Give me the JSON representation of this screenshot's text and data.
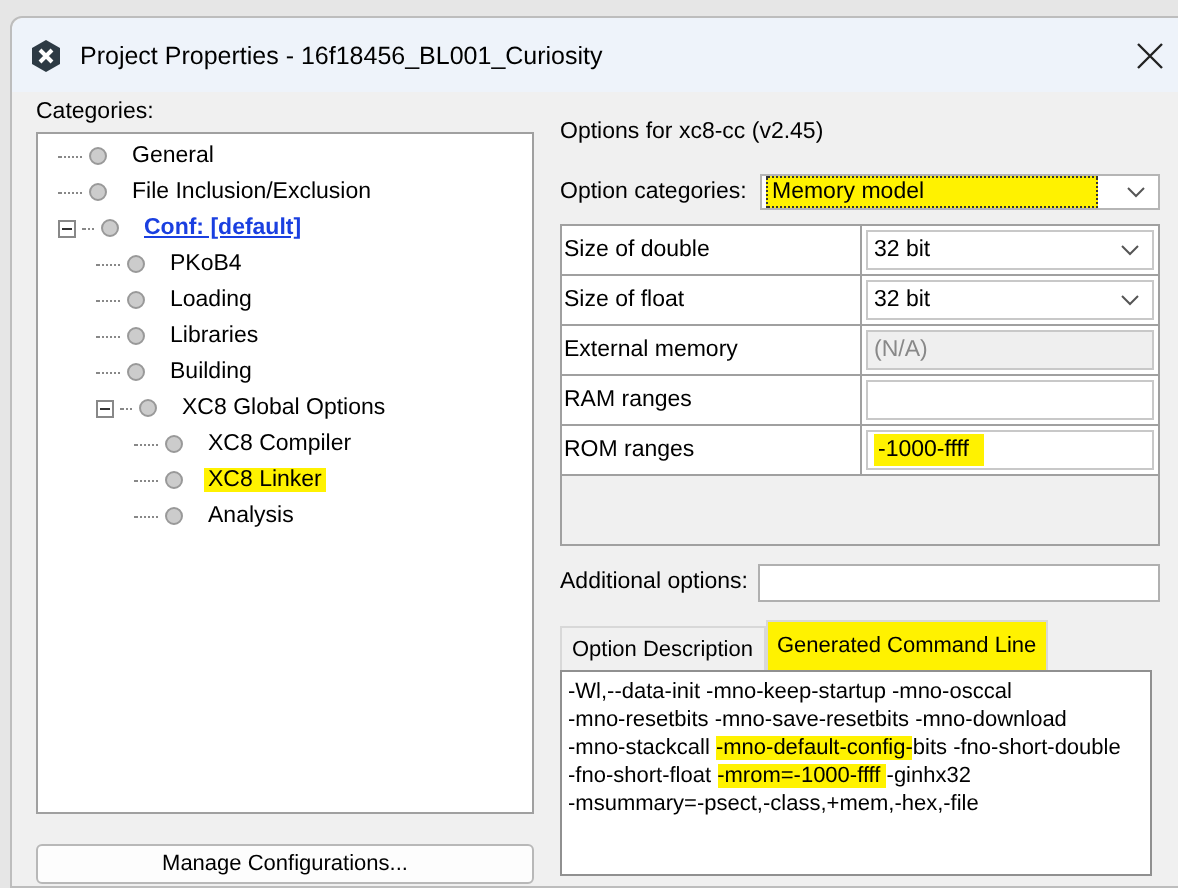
{
  "window": {
    "title": "Project Properties - 16f18456_BL001_Curiosity"
  },
  "categories": {
    "label": "Categories:",
    "items": [
      {
        "label": "General",
        "active": false,
        "highlighted": false
      },
      {
        "label": "File Inclusion/Exclusion",
        "active": false,
        "highlighted": false
      },
      {
        "label": "Conf: [default]",
        "active": true,
        "highlighted": false,
        "expanded": true,
        "children": [
          {
            "label": "PKoB4",
            "active": false,
            "highlighted": false
          },
          {
            "label": "Loading",
            "active": false,
            "highlighted": false
          },
          {
            "label": "Libraries",
            "active": false,
            "highlighted": false
          },
          {
            "label": "Building",
            "active": false,
            "highlighted": false
          },
          {
            "label": "XC8 Global Options",
            "active": false,
            "highlighted": false,
            "expanded": true,
            "children": [
              {
                "label": "XC8 Compiler",
                "active": false,
                "highlighted": false
              },
              {
                "label": "XC8 Linker",
                "active": false,
                "highlighted": true
              },
              {
                "label": "Analysis",
                "active": false,
                "highlighted": false
              }
            ]
          }
        ]
      }
    ]
  },
  "manage_button": "Manage Configurations...",
  "options_title": "Options for xc8-cc (v2.45)",
  "option_categories": {
    "label": "Option categories:",
    "value": "Memory model",
    "highlighted": true
  },
  "options": [
    {
      "name": "Size of double",
      "kind": "dropdown",
      "value": "32 bit",
      "highlighted": false
    },
    {
      "name": "Size of float",
      "kind": "dropdown",
      "value": "32 bit",
      "highlighted": false
    },
    {
      "name": "External memory",
      "kind": "disabled",
      "value": "(N/A)",
      "highlighted": false
    },
    {
      "name": "RAM ranges",
      "kind": "text",
      "highlighted": false
    },
    {
      "name": "ROM ranges",
      "kind": "text",
      "value": "-1000-ffff",
      "highlighted": true
    }
  ],
  "additional_options": {
    "label": "Additional options:"
  },
  "tabs": [
    {
      "label": "Option Description",
      "selected": false,
      "highlighted": false
    },
    {
      "label": "Generated Command Line",
      "selected": true,
      "highlighted": true
    }
  ],
  "command_line": [
    [
      {
        "text": "-Wl,--data-init -mno-keep-startup -mno-osccal",
        "highlighted": false
      }
    ],
    [
      {
        "text": "-mno-resetbits -mno-save-resetbits -mno-download",
        "highlighted": false
      }
    ],
    [
      {
        "text": "-mno-stackcall ",
        "highlighted": false
      },
      {
        "text": "-mno-default-config-",
        "highlighted": true
      },
      {
        "text": "bits -fno-short-double",
        "highlighted": false
      }
    ],
    [
      {
        "text": "-fno-short-float ",
        "highlighted": false
      },
      {
        "text": "-mrom=-1000-ffff ",
        "highlighted": true
      },
      {
        "text": "-ginhx32",
        "highlighted": false
      }
    ],
    [
      {
        "text": "-msummary=-psect,-class,+mem,-hex,-file",
        "highlighted": false
      }
    ]
  ]
}
